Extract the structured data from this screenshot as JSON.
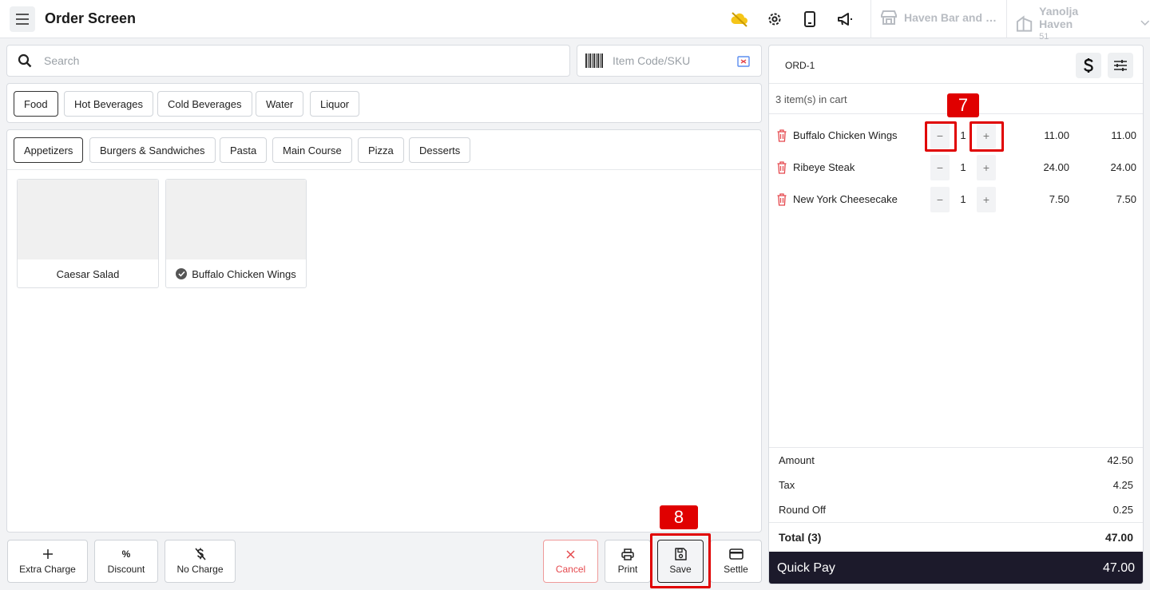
{
  "header": {
    "title": "Order Screen",
    "store_name": "Haven Bar and Restaurant",
    "property_name": "Yanolja Haven",
    "property_number": "51"
  },
  "search": {
    "placeholder": "Search"
  },
  "sku": {
    "placeholder": "Item Code/SKU"
  },
  "categories": [
    "Food",
    "Hot Beverages",
    "Cold Beverages",
    "Water",
    "Liquor"
  ],
  "subcategories": [
    "Appetizers",
    "Burgers & Sandwiches",
    "Pasta",
    "Main Course",
    "Pizza",
    "Desserts"
  ],
  "products": [
    {
      "name": "Caesar Salad",
      "selected": false
    },
    {
      "name": "Buffalo Chicken Wings",
      "selected": true
    }
  ],
  "actions": {
    "extra_charge": "Extra Charge",
    "discount": "Discount",
    "discount_symbol": "%",
    "no_charge": "No Charge",
    "cancel": "Cancel",
    "print": "Print",
    "save": "Save",
    "settle": "Settle"
  },
  "annotations": {
    "step7": "7",
    "step8": "8"
  },
  "cart": {
    "order_id": "ORD-1",
    "items_count_text": "3 item(s) in cart",
    "items": [
      {
        "name": "Buffalo Chicken Wings",
        "qty": "1",
        "price": "11.00",
        "total": "11.00"
      },
      {
        "name": "Ribeye Steak",
        "qty": "1",
        "price": "24.00",
        "total": "24.00"
      },
      {
        "name": "New York Cheesecake",
        "qty": "1",
        "price": "7.50",
        "total": "7.50"
      }
    ],
    "summary": {
      "amount_label": "Amount",
      "amount": "42.50",
      "tax_label": "Tax",
      "tax": "4.25",
      "roundoff_label": "Round Off",
      "roundoff": "0.25",
      "total_label": "Total (3)",
      "total": "47.00"
    },
    "quick_pay_label": "Quick Pay",
    "quick_pay_amount": "47.00"
  },
  "colors": {
    "accent_dark": "#1c1a2b",
    "danger": "#e5484d",
    "annotation": "#e00000"
  }
}
